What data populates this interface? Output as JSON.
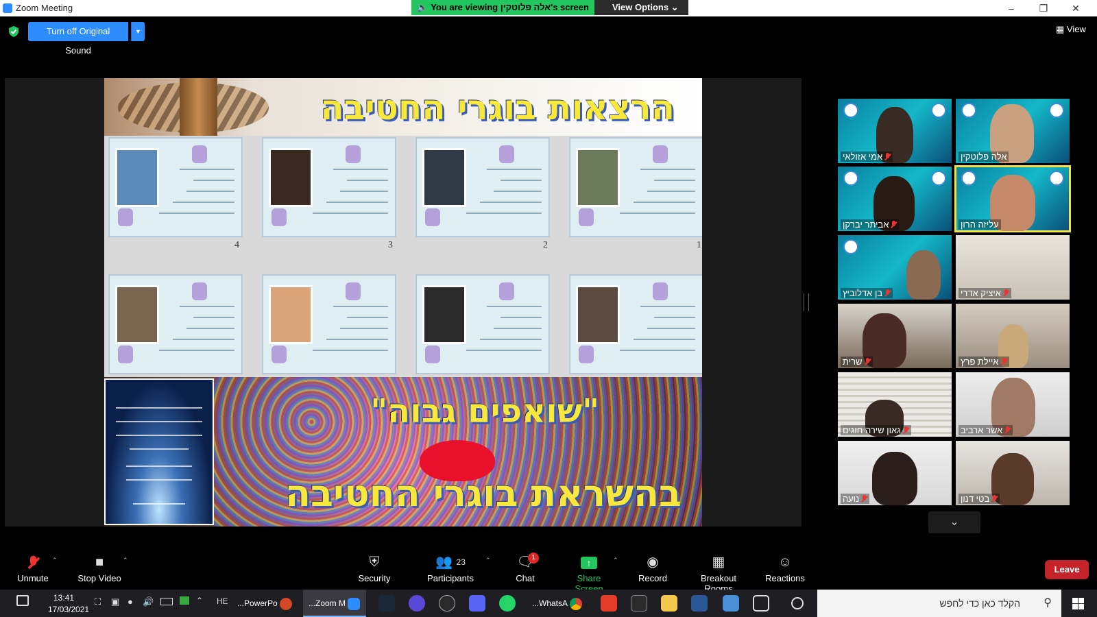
{
  "window": {
    "title": "Zoom Meeting",
    "minimize": "–",
    "maximize": "❐",
    "close": "✕"
  },
  "share_banner": {
    "viewing": "You are viewing אלה פלוטקין's screen",
    "view_options": "View Options"
  },
  "top": {
    "original_sound": "Turn off Original Sound",
    "view": "View"
  },
  "slide": {
    "title": "הרצאות בוגרי החטיבה",
    "cert_numbers": [
      "4",
      "3",
      "2",
      "1"
    ],
    "banner_line1": "\"שואפים גבוה\"",
    "banner_line2": "בהשראת בוגרי החטיבה"
  },
  "participants": [
    {
      "name": "אמי אזולאי",
      "muted": true
    },
    {
      "name": "אלה פלוטקין",
      "muted": false
    },
    {
      "name": "אביתר יברקן",
      "muted": true
    },
    {
      "name": "עליזה הרון",
      "muted": false,
      "active": true
    },
    {
      "name": "בן אדלוביץ",
      "muted": true
    },
    {
      "name": "איציק אדרי",
      "muted": true
    },
    {
      "name": "שרית",
      "muted": true
    },
    {
      "name": "איילת פרץ",
      "muted": true
    },
    {
      "name": "גאון שירה חוגים",
      "muted": true
    },
    {
      "name": "אשר ארביב",
      "muted": true
    },
    {
      "name": "נועה",
      "muted": true
    },
    {
      "name": "בטי דנון",
      "muted": true
    }
  ],
  "toolbar": {
    "unmute": "Unmute",
    "stop_video": "Stop Video",
    "security": "Security",
    "participants": "Participants",
    "participants_count": "23",
    "chat": "Chat",
    "chat_badge": "1",
    "share_screen": "Share Screen",
    "record": "Record",
    "breakout_rooms": "Breakout Rooms",
    "reactions": "Reactions",
    "leave": "Leave"
  },
  "taskbar": {
    "time": "13:41",
    "date": "17/03/2021",
    "lang": "HE",
    "powerpoint": "...PowerPo",
    "zoom": "...Zoom M",
    "whatsapp": "...WhatsA",
    "search_placeholder": "הקלד כאן כדי לחפש"
  },
  "colors": {
    "accent": "#2D8CFF",
    "share_green": "#22c55e",
    "leave_red": "#c5232a",
    "active_speaker": "#f0e445"
  }
}
